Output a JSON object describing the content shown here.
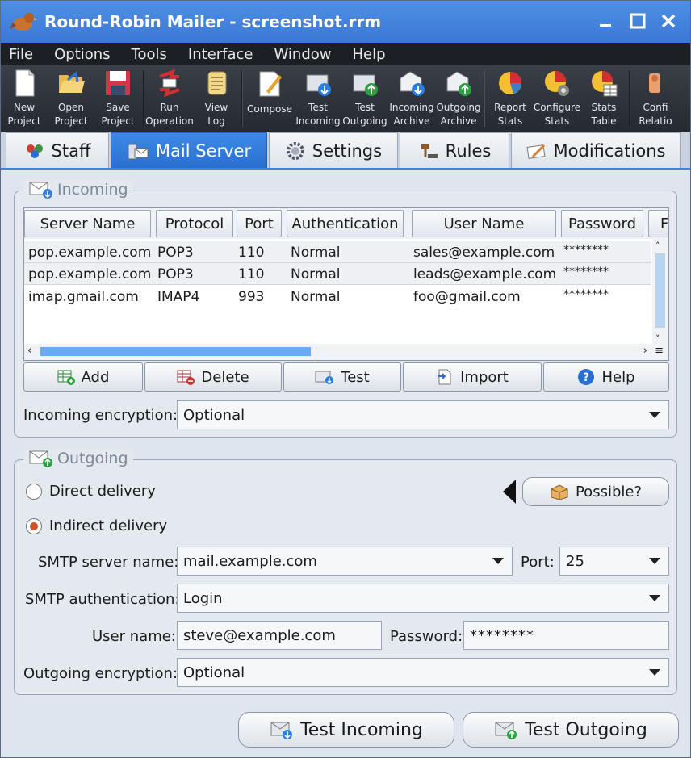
{
  "window": {
    "title": "Round-Robin Mailer - screenshot.rrm"
  },
  "menu": [
    "File",
    "Options",
    "Tools",
    "Interface",
    "Window",
    "Help"
  ],
  "toolbar": [
    {
      "line1": "New",
      "line2": "Project",
      "icon": "new-project-icon"
    },
    {
      "line1": "Open",
      "line2": "Project",
      "icon": "open-project-icon"
    },
    {
      "line1": "Save",
      "line2": "Project",
      "icon": "save-project-icon"
    },
    {
      "line1": "Run",
      "line2": "Operation",
      "icon": "run-operation-icon"
    },
    {
      "line1": "View",
      "line2": "Log",
      "icon": "view-log-icon"
    },
    {
      "line1": "Compose",
      "line2": "",
      "icon": "compose-icon"
    },
    {
      "line1": "Test",
      "line2": "Incoming",
      "icon": "test-incoming-icon"
    },
    {
      "line1": "Test",
      "line2": "Outgoing",
      "icon": "test-outgoing-icon"
    },
    {
      "line1": "Incoming",
      "line2": "Archive",
      "icon": "incoming-archive-icon"
    },
    {
      "line1": "Outgoing",
      "line2": "Archive",
      "icon": "outgoing-archive-icon"
    },
    {
      "line1": "Report",
      "line2": "Stats",
      "icon": "report-stats-icon"
    },
    {
      "line1": "Configure",
      "line2": "Stats",
      "icon": "configure-stats-icon"
    },
    {
      "line1": "Stats",
      "line2": "Table",
      "icon": "stats-table-icon"
    },
    {
      "line1": "Confi",
      "line2": "Relatio",
      "icon": "configure-relations-icon"
    }
  ],
  "tabs": [
    {
      "label": "Staff",
      "active": false
    },
    {
      "label": "Mail Server",
      "active": true
    },
    {
      "label": "Settings",
      "active": false
    },
    {
      "label": "Rules",
      "active": false
    },
    {
      "label": "Modifications",
      "active": false
    }
  ],
  "incoming": {
    "title": "Incoming",
    "columns": [
      "Server Name",
      "Protocol",
      "Port",
      "Authentication",
      "User Name",
      "Password",
      "Fo"
    ],
    "rows": [
      [
        "pop.example.com",
        "POP3",
        "110",
        "Normal",
        "sales@example.com",
        "********"
      ],
      [
        "pop.example.com",
        "POP3",
        "110",
        "Normal",
        "leads@example.com",
        "********"
      ],
      [
        "imap.gmail.com",
        "IMAP4",
        "993",
        "Normal",
        "foo@gmail.com",
        "********"
      ]
    ],
    "buttons": {
      "add": "Add",
      "delete": "Delete",
      "test": "Test",
      "import": "Import",
      "help": "Help"
    },
    "encryption_label": "Incoming encryption:",
    "encryption_value": "Optional"
  },
  "outgoing": {
    "title": "Outgoing",
    "direct_label": "Direct delivery",
    "indirect_label": "Indirect delivery",
    "delivery_mode": "indirect",
    "possible_button": "Possible?",
    "smtp_server_label": "SMTP server name:",
    "smtp_server_value": "mail.example.com",
    "port_label": "Port:",
    "port_value": "25",
    "smtp_auth_label": "SMTP authentication:",
    "smtp_auth_value": "Login",
    "user_label": "User name:",
    "user_value": "steve@example.com",
    "password_label": "Password:",
    "password_value": "********",
    "encryption_label": "Outgoing encryption:",
    "encryption_value": "Optional"
  },
  "footer": {
    "test_incoming": "Test Incoming",
    "test_outgoing": "Test Outgoing"
  }
}
